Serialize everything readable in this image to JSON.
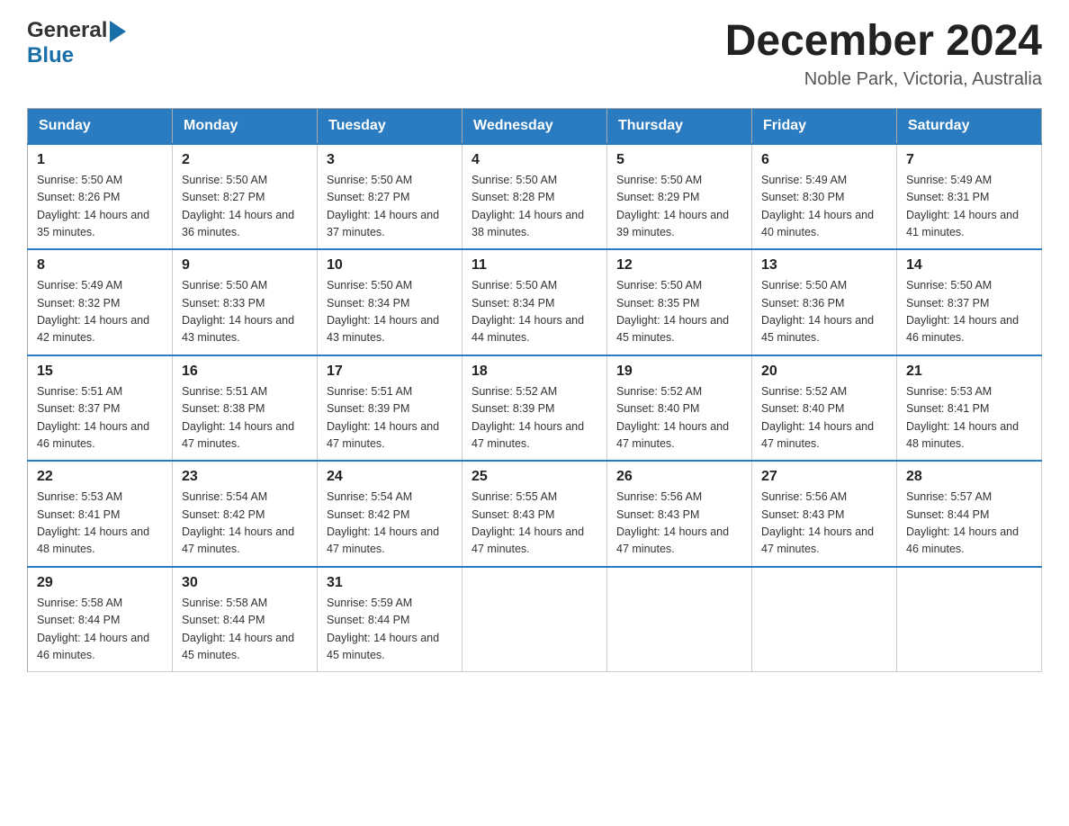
{
  "logo": {
    "general": "General",
    "blue": "Blue"
  },
  "title": "December 2024",
  "location": "Noble Park, Victoria, Australia",
  "days_of_week": [
    "Sunday",
    "Monday",
    "Tuesday",
    "Wednesday",
    "Thursday",
    "Friday",
    "Saturday"
  ],
  "weeks": [
    [
      {
        "day": 1,
        "sunrise": "5:50 AM",
        "sunset": "8:26 PM",
        "daylight": "14 hours and 35 minutes."
      },
      {
        "day": 2,
        "sunrise": "5:50 AM",
        "sunset": "8:27 PM",
        "daylight": "14 hours and 36 minutes."
      },
      {
        "day": 3,
        "sunrise": "5:50 AM",
        "sunset": "8:27 PM",
        "daylight": "14 hours and 37 minutes."
      },
      {
        "day": 4,
        "sunrise": "5:50 AM",
        "sunset": "8:28 PM",
        "daylight": "14 hours and 38 minutes."
      },
      {
        "day": 5,
        "sunrise": "5:50 AM",
        "sunset": "8:29 PM",
        "daylight": "14 hours and 39 minutes."
      },
      {
        "day": 6,
        "sunrise": "5:49 AM",
        "sunset": "8:30 PM",
        "daylight": "14 hours and 40 minutes."
      },
      {
        "day": 7,
        "sunrise": "5:49 AM",
        "sunset": "8:31 PM",
        "daylight": "14 hours and 41 minutes."
      }
    ],
    [
      {
        "day": 8,
        "sunrise": "5:49 AM",
        "sunset": "8:32 PM",
        "daylight": "14 hours and 42 minutes."
      },
      {
        "day": 9,
        "sunrise": "5:50 AM",
        "sunset": "8:33 PM",
        "daylight": "14 hours and 43 minutes."
      },
      {
        "day": 10,
        "sunrise": "5:50 AM",
        "sunset": "8:34 PM",
        "daylight": "14 hours and 43 minutes."
      },
      {
        "day": 11,
        "sunrise": "5:50 AM",
        "sunset": "8:34 PM",
        "daylight": "14 hours and 44 minutes."
      },
      {
        "day": 12,
        "sunrise": "5:50 AM",
        "sunset": "8:35 PM",
        "daylight": "14 hours and 45 minutes."
      },
      {
        "day": 13,
        "sunrise": "5:50 AM",
        "sunset": "8:36 PM",
        "daylight": "14 hours and 45 minutes."
      },
      {
        "day": 14,
        "sunrise": "5:50 AM",
        "sunset": "8:37 PM",
        "daylight": "14 hours and 46 minutes."
      }
    ],
    [
      {
        "day": 15,
        "sunrise": "5:51 AM",
        "sunset": "8:37 PM",
        "daylight": "14 hours and 46 minutes."
      },
      {
        "day": 16,
        "sunrise": "5:51 AM",
        "sunset": "8:38 PM",
        "daylight": "14 hours and 47 minutes."
      },
      {
        "day": 17,
        "sunrise": "5:51 AM",
        "sunset": "8:39 PM",
        "daylight": "14 hours and 47 minutes."
      },
      {
        "day": 18,
        "sunrise": "5:52 AM",
        "sunset": "8:39 PM",
        "daylight": "14 hours and 47 minutes."
      },
      {
        "day": 19,
        "sunrise": "5:52 AM",
        "sunset": "8:40 PM",
        "daylight": "14 hours and 47 minutes."
      },
      {
        "day": 20,
        "sunrise": "5:52 AM",
        "sunset": "8:40 PM",
        "daylight": "14 hours and 47 minutes."
      },
      {
        "day": 21,
        "sunrise": "5:53 AM",
        "sunset": "8:41 PM",
        "daylight": "14 hours and 48 minutes."
      }
    ],
    [
      {
        "day": 22,
        "sunrise": "5:53 AM",
        "sunset": "8:41 PM",
        "daylight": "14 hours and 48 minutes."
      },
      {
        "day": 23,
        "sunrise": "5:54 AM",
        "sunset": "8:42 PM",
        "daylight": "14 hours and 47 minutes."
      },
      {
        "day": 24,
        "sunrise": "5:54 AM",
        "sunset": "8:42 PM",
        "daylight": "14 hours and 47 minutes."
      },
      {
        "day": 25,
        "sunrise": "5:55 AM",
        "sunset": "8:43 PM",
        "daylight": "14 hours and 47 minutes."
      },
      {
        "day": 26,
        "sunrise": "5:56 AM",
        "sunset": "8:43 PM",
        "daylight": "14 hours and 47 minutes."
      },
      {
        "day": 27,
        "sunrise": "5:56 AM",
        "sunset": "8:43 PM",
        "daylight": "14 hours and 47 minutes."
      },
      {
        "day": 28,
        "sunrise": "5:57 AM",
        "sunset": "8:44 PM",
        "daylight": "14 hours and 46 minutes."
      }
    ],
    [
      {
        "day": 29,
        "sunrise": "5:58 AM",
        "sunset": "8:44 PM",
        "daylight": "14 hours and 46 minutes."
      },
      {
        "day": 30,
        "sunrise": "5:58 AM",
        "sunset": "8:44 PM",
        "daylight": "14 hours and 45 minutes."
      },
      {
        "day": 31,
        "sunrise": "5:59 AM",
        "sunset": "8:44 PM",
        "daylight": "14 hours and 45 minutes."
      },
      null,
      null,
      null,
      null
    ]
  ]
}
